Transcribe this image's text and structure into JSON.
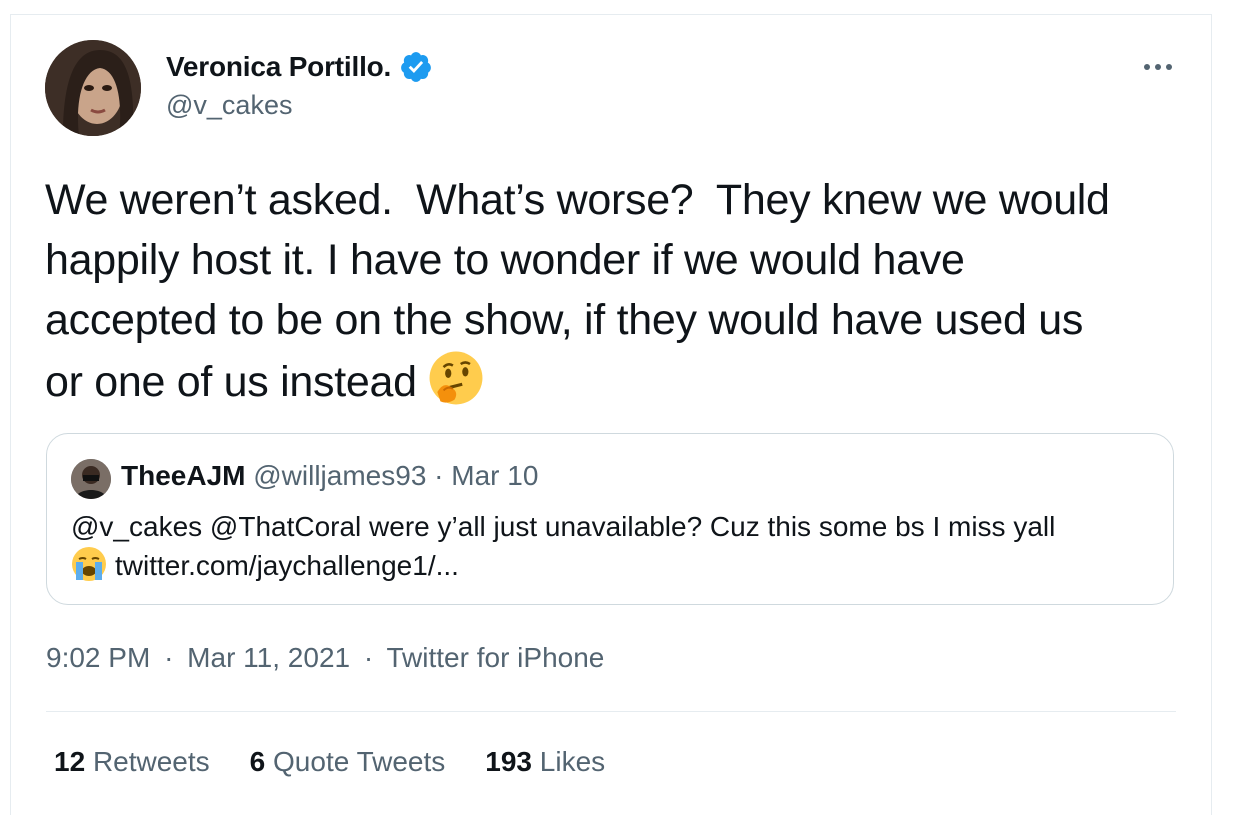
{
  "tweet": {
    "author": {
      "display_name": "Veronica Portillo.",
      "handle": "@v_cakes",
      "verified": true,
      "avatar_icon": "profile-photo"
    },
    "text_lines": [
      "We weren’t asked.  What’s worse?  They knew we would",
      "happily host it. I have to wonder if we would have",
      "accepted to be on the show, if they would have used us",
      "or one of us instead "
    ],
    "text_emoji": "thinking-face-emoji",
    "quoted_tweet": {
      "display_name": "TheeAJM",
      "handle": "@willjames93",
      "separator": "·",
      "date": "Mar 10",
      "body_line1": "@v_cakes @ThatCoral were y’all just unavailable? Cuz this some bs I miss yall",
      "body_line2": "twitter.com/jaychallenge1/...",
      "body_emoji": "loudly-crying-face-emoji"
    },
    "time": "9:02 PM",
    "date": "Mar 11, 2021",
    "source": "Twitter for iPhone",
    "separator": "·",
    "stats": {
      "retweets_count": "12",
      "retweets_label": "Retweets",
      "quotes_count": "6",
      "quotes_label": "Quote Tweets",
      "likes_count": "193",
      "likes_label": "Likes"
    }
  },
  "colors": {
    "primary_text": "#0f1419",
    "secondary_text": "#536471",
    "verified_blue": "#1d9bf0",
    "border": "#cfd9de"
  }
}
